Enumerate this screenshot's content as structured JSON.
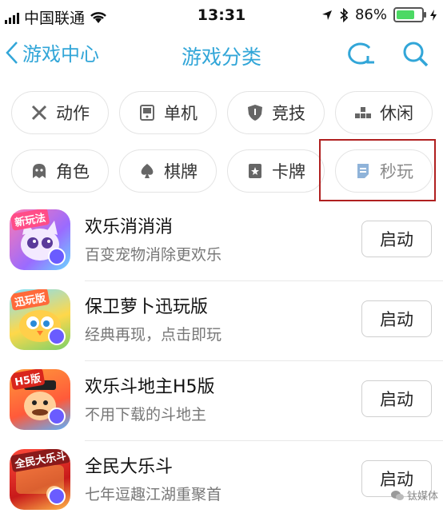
{
  "status_bar": {
    "carrier": "中国联通",
    "time": "13:31",
    "battery_percent": "86%",
    "battery_level": 0.86
  },
  "nav": {
    "back_label": "游戏中心",
    "title": "游戏分类",
    "accent_color": "#32a6d8"
  },
  "categories": [
    {
      "label": "动作",
      "icon": "crossed-swords-icon"
    },
    {
      "label": "单机",
      "icon": "gamepad-icon"
    },
    {
      "label": "竞技",
      "icon": "shield-icon"
    },
    {
      "label": "休闲",
      "icon": "blocks-icon"
    },
    {
      "label": "角色",
      "icon": "ghost-icon"
    },
    {
      "label": "棋牌",
      "icon": "spade-icon"
    },
    {
      "label": "卡牌",
      "icon": "star-card-icon"
    },
    {
      "label": "秒玩",
      "icon": "document-icon"
    }
  ],
  "games": [
    {
      "name": "欢乐消消消",
      "desc": "百变宠物消除更欢乐",
      "button": "启动",
      "badge": "新玩法"
    },
    {
      "name": "保卫萝卜迅玩版",
      "desc": "经典再现，点击即玩",
      "button": "启动",
      "badge": "迅玩版"
    },
    {
      "name": "欢乐斗地主H5版",
      "desc": "不用下载的斗地主",
      "button": "启动",
      "badge": "H5版"
    },
    {
      "name": "全民大乐斗",
      "desc": "七年逗趣江湖重聚首",
      "button": "启动",
      "badge": "全民大乐斗"
    }
  ],
  "watermark": "钛媒体"
}
